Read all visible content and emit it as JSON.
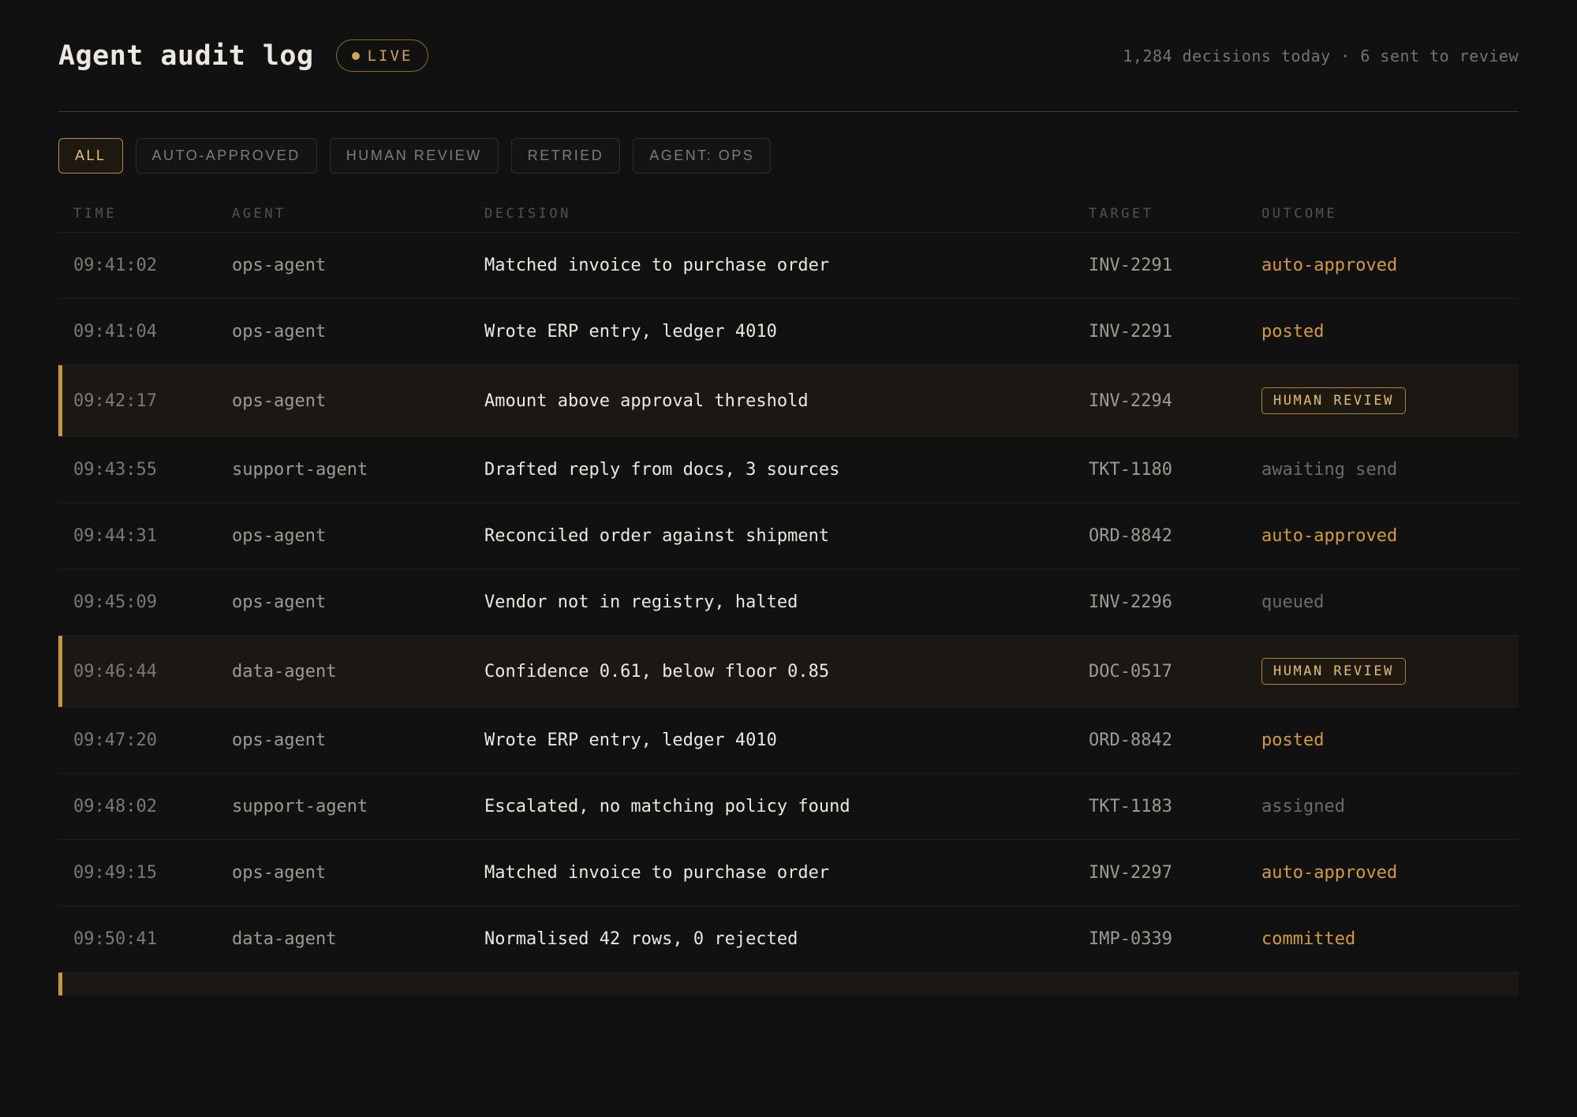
{
  "header": {
    "title": "Agent audit log",
    "live_label": "LIVE",
    "summary": "1,284 decisions today · 6 sent to review"
  },
  "filters": [
    {
      "label": "ALL",
      "active": true
    },
    {
      "label": "AUTO-APPROVED",
      "active": false
    },
    {
      "label": "HUMAN REVIEW",
      "active": false
    },
    {
      "label": "RETRIED",
      "active": false
    },
    {
      "label": "AGENT: OPS",
      "active": false
    }
  ],
  "columns": {
    "time": "TIME",
    "agent": "AGENT",
    "decision": "DECISION",
    "target": "TARGET",
    "outcome": "OUTCOME"
  },
  "rows": [
    {
      "time": "09:41:02",
      "agent": "ops-agent",
      "decision": "Matched invoice to purchase order",
      "target": "INV-2291",
      "outcome": "auto-approved",
      "style": "amber"
    },
    {
      "time": "09:41:04",
      "agent": "ops-agent",
      "decision": "Wrote ERP entry, ledger 4010",
      "target": "INV-2291",
      "outcome": "posted",
      "style": "amber"
    },
    {
      "time": "09:42:17",
      "agent": "ops-agent",
      "decision": "Amount above approval threshold",
      "target": "INV-2294",
      "outcome": "HUMAN REVIEW",
      "style": "badge"
    },
    {
      "time": "09:43:55",
      "agent": "support-agent",
      "decision": "Drafted reply from docs, 3 sources",
      "target": "TKT-1180",
      "outcome": "awaiting send",
      "style": "gray"
    },
    {
      "time": "09:44:31",
      "agent": "ops-agent",
      "decision": "Reconciled order against shipment",
      "target": "ORD-8842",
      "outcome": "auto-approved",
      "style": "amber"
    },
    {
      "time": "09:45:09",
      "agent": "ops-agent",
      "decision": "Vendor not in registry, halted",
      "target": "INV-2296",
      "outcome": "queued",
      "style": "gray"
    },
    {
      "time": "09:46:44",
      "agent": "data-agent",
      "decision": "Confidence 0.61, below floor 0.85",
      "target": "DOC-0517",
      "outcome": "HUMAN REVIEW",
      "style": "badge"
    },
    {
      "time": "09:47:20",
      "agent": "ops-agent",
      "decision": "Wrote ERP entry, ledger 4010",
      "target": "ORD-8842",
      "outcome": "posted",
      "style": "amber"
    },
    {
      "time": "09:48:02",
      "agent": "support-agent",
      "decision": "Escalated, no matching policy found",
      "target": "TKT-1183",
      "outcome": "assigned",
      "style": "gray"
    },
    {
      "time": "09:49:15",
      "agent": "ops-agent",
      "decision": "Matched invoice to purchase order",
      "target": "INV-2297",
      "outcome": "auto-approved",
      "style": "amber"
    },
    {
      "time": "09:50:41",
      "agent": "data-agent",
      "decision": "Normalised 42 rows, 0 rejected",
      "target": "IMP-0339",
      "outcome": "committed",
      "style": "amber"
    }
  ],
  "colors": {
    "background": "#111111",
    "accent": "#d49b3c",
    "text": "#ece8df",
    "muted": "#6e6b65"
  }
}
